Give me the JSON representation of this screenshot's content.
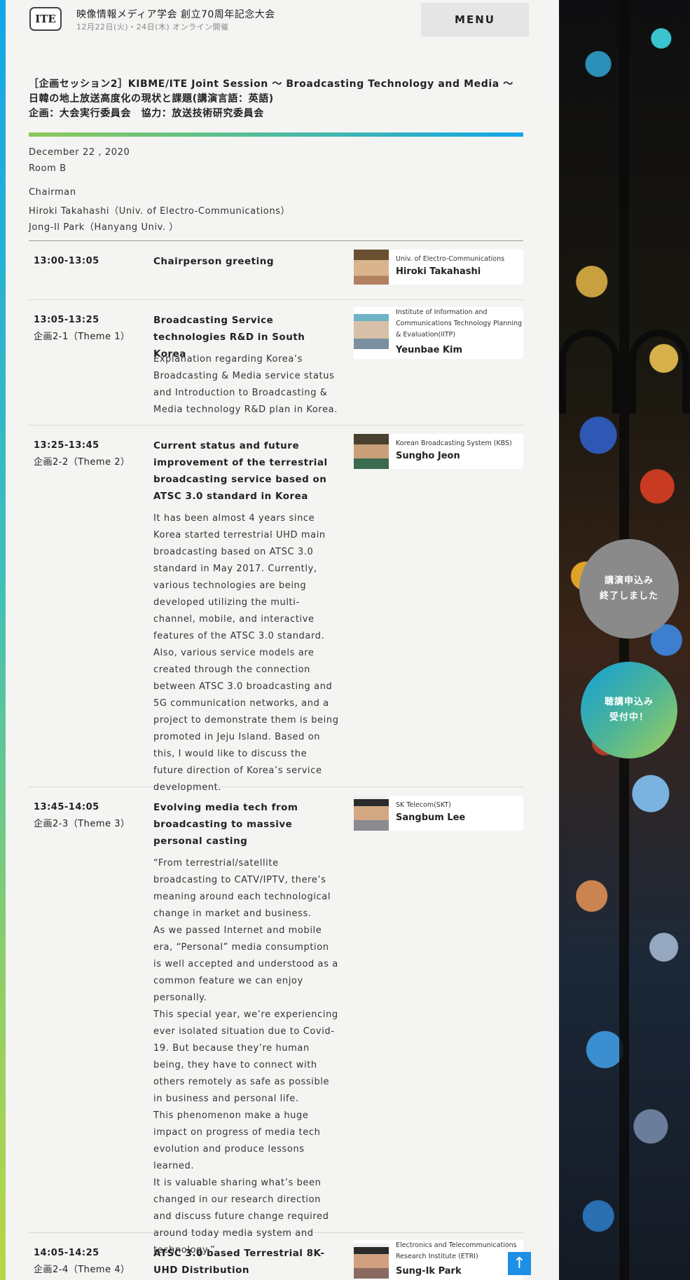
{
  "header": {
    "logo_text": "ITE",
    "title": "映像情報メディア学会 創立70周年記念大会",
    "subtitle": "12月22日(火)・24日(木) オンライン開催",
    "menu_label": "MENU"
  },
  "session": {
    "title_lines": [
      "［企画セッション2］KIBME/ITE Joint Session 〜 Broadcasting Technology and Media 〜 日韓の地上放送高度化の現状と課題(講演言語：英語)",
      "企画：大会実行委員会　協力：放送技術研究委員会"
    ],
    "date": "December 22 , 2020",
    "room": "Room B",
    "chairman_label": "Chairman",
    "chairs": [
      "Hiroki Takahashi（Univ. of Electro-Communications）",
      "Jong-Il Park（Hanyang Univ. ）"
    ]
  },
  "program": [
    {
      "time": "13:00-13:05",
      "code": "",
      "title": "Chairperson greeting",
      "abstract": "",
      "speaker": {
        "affiliation": "Univ. of Electro-Communications",
        "name": "Hiroki Takahashi"
      }
    },
    {
      "time": "13:05-13:25",
      "code": "企画2-1（Theme 1）",
      "title": "Broadcasting Service technologies R&D in South Korea",
      "abstract": "Explanation regarding Korea’s Broadcasting & Media service status and Introduction to Broadcasting & Media technology R&D plan in Korea.",
      "speaker": {
        "affiliation": "Institute of Information and Communications Technology Planning & Evaluation(IITP)",
        "name": "Yeunbae Kim"
      }
    },
    {
      "time": "13:25-13:45",
      "code": "企画2-2（Theme 2）",
      "title": "Current status and future improvement of the terrestrial broadcasting service based on ATSC 3.0 standard in Korea",
      "abstract": "It has been almost 4 years since Korea started terrestrial UHD main broadcasting based on ATSC 3.0 standard in May 2017. Currently, various technologies are being developed utilizing the multi-channel, mobile, and interactive features of the ATSC 3.0 standard. Also, various service models are created through the connection between ATSC 3.0 broadcasting and 5G communication networks, and a project to demonstrate them is being promoted in Jeju Island. Based on this, I would like to discuss the future direction of Korea’s service development.",
      "speaker": {
        "affiliation": "Korean Broadcasting System (KBS)",
        "name": "Sungho Jeon"
      }
    },
    {
      "time": "13:45-14:05",
      "code": "企画2-3（Theme 3）",
      "title": "Evolving media tech from broadcasting to massive personal casting",
      "abstract": "“From terrestrial/satellite broadcasting to CATV/IPTV, there’s meaning around each technological change in market and business.\nAs we passed Internet and mobile era, “Personal” media consumption is well accepted and understood as a common feature we can enjoy personally.\nThis special year, we’re experiencing ever isolated situation due to Covid-19. But because they’re human being, they have to connect with others remotely as safe as possible in business and personal life.\nThis phenomenon make a huge impact on progress of media tech evolution and produce lessons learned.\nIt is valuable sharing what’s been changed in our research direction and discuss future change required around today media system and technology.”",
      "speaker": {
        "affiliation": "SK Telecom(SKT)",
        "name": "Sangbum Lee"
      }
    },
    {
      "time": "14:05-14:25",
      "code": "企画2-4（Theme 4）",
      "title": "ATSC 3.0 based Terrestrial 8K-UHD Distribution",
      "abstract": "",
      "speaker": {
        "affiliation": "Electronics and Telecommunications Research Institute (ETRI)",
        "name": "Sung-Ik Park"
      }
    }
  ],
  "floating": {
    "lecture_closed": "講演申込み\n終了しました",
    "audience_open": "聴講申込み\n受付中！",
    "scroll_top": "↑"
  }
}
